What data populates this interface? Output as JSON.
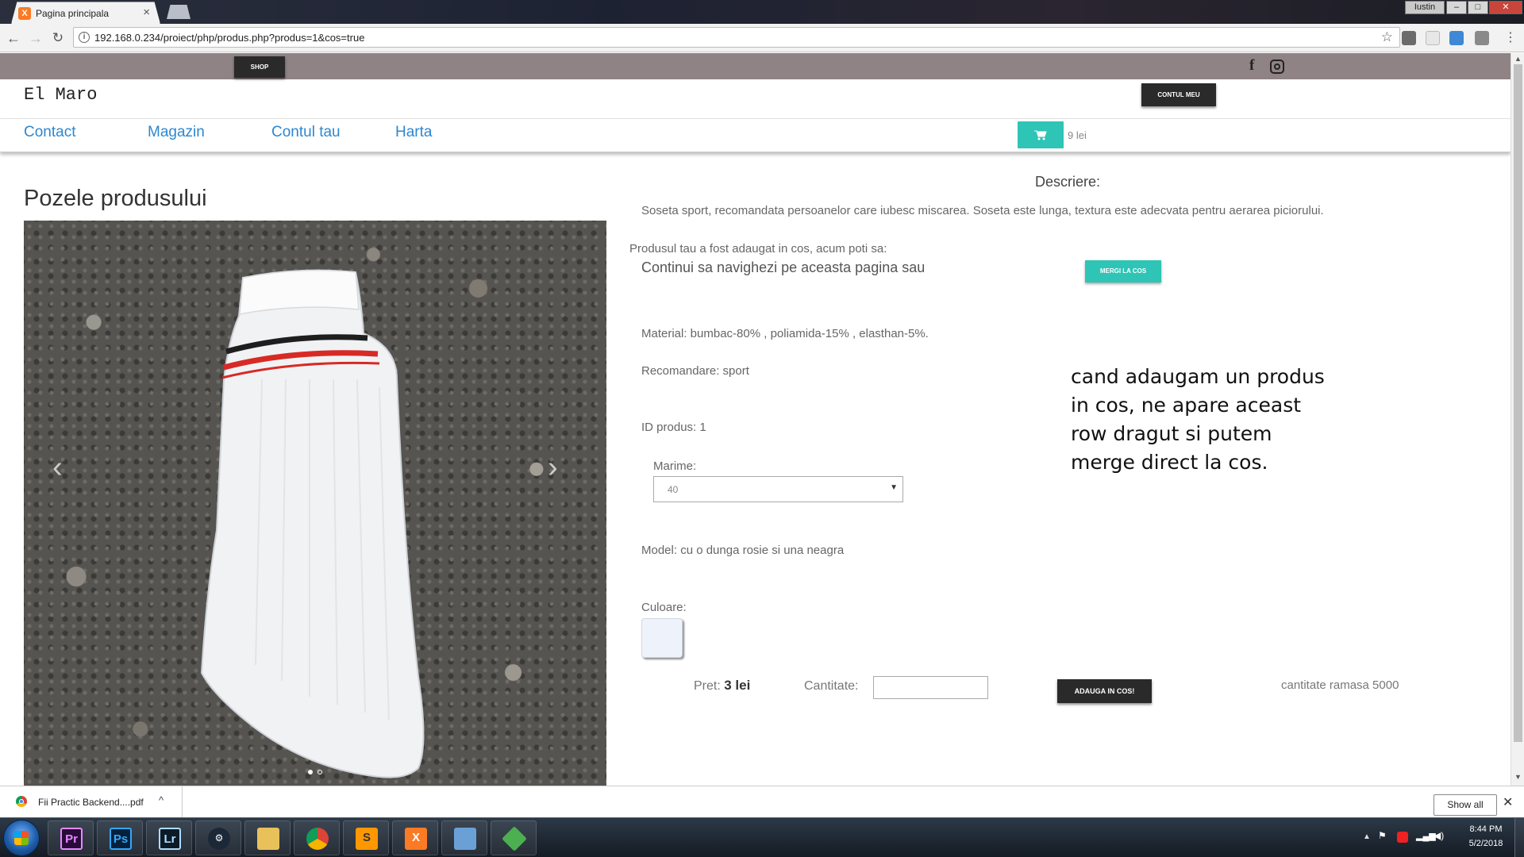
{
  "browser": {
    "tab_title": "Pagina principala",
    "tab_close": "×",
    "window_user": "Iustin",
    "window_controls": {
      "minimize": "‒",
      "maximize": "□",
      "close": "✕"
    },
    "url": "192.168.0.234/proiect/php/produs.php?produs=1&cos=true",
    "icons": {
      "back": "←",
      "forward": "→",
      "reload": "↻",
      "star": "☆",
      "menu": "⋮"
    }
  },
  "topbar": {
    "shop_label": "SHOP",
    "social": [
      "facebook-icon",
      "instagram-icon"
    ],
    "facebook_glyph": "f"
  },
  "header": {
    "brand": "El Maro",
    "account_label": "CONTUL MEU"
  },
  "nav": {
    "links": [
      "Contact",
      "Magazin",
      "Contul tau",
      "Harta"
    ],
    "cart_total": "9 lei"
  },
  "product": {
    "photos_title": "Pozele produsului",
    "carousel": {
      "prev": "‹",
      "next": "›",
      "slides": 2,
      "active_slide": 1
    },
    "description_heading": "Descriere:",
    "description": "Soseta sport, recomandata persoanelor care iubesc miscarea.  Soseta este lunga, textura este adecvata pentru aerarea piciorului.",
    "added_notice": "Produsul tau a fost adaugat in cos, acum poti sa:",
    "continue_text": "Continui sa navighezi pe aceasta pagina sau",
    "go_to_cart_label": "MERGI LA COS",
    "material": "Material: bumbac-80% , poliamida-15% , elasthan-5%.",
    "recomandare": "Recomandare: sport",
    "id_produs": "ID produs: 1",
    "marime_label": "Marime:",
    "marime_value": "40",
    "model": "Model: cu o dunga rosie si una neagra",
    "culoare_label": "Culoare:",
    "color_swatch": "#eef3fb",
    "price_label": "Pret:",
    "price_value": "3 lei",
    "quantity_label": "Cantitate:",
    "quantity_value": "",
    "add_to_cart_label": "ADAUGA IN COS!",
    "stock": "cantitate ramasa 5000"
  },
  "annotation": {
    "lines": [
      "cand adaugam un produs",
      "in cos, ne apare aceast",
      "row dragut si putem",
      "merge direct la cos."
    ]
  },
  "download_bar": {
    "file_name": "Fii Practic Backend....pdf",
    "show_all_label": "Show all",
    "chevron": "^",
    "close": "✕"
  },
  "taskbar": {
    "apps": [
      {
        "name": "premiere",
        "label": "Pr"
      },
      {
        "name": "photoshop",
        "label": "Ps"
      },
      {
        "name": "lightroom",
        "label": "Lr"
      },
      {
        "name": "steam",
        "label": "⚙"
      },
      {
        "name": "explorer",
        "label": ""
      },
      {
        "name": "chrome",
        "label": ""
      },
      {
        "name": "sublime",
        "label": "S"
      },
      {
        "name": "xampp",
        "label": "X"
      },
      {
        "name": "screen",
        "label": ""
      },
      {
        "name": "app",
        "label": ""
      }
    ],
    "time": "8:44 PM",
    "date": "5/2/2018"
  },
  "colors": {
    "accent": "#2ec4b6",
    "dark_button": "#2a2a2a",
    "topbar": "#8f8385",
    "link": "#2e87d0"
  }
}
